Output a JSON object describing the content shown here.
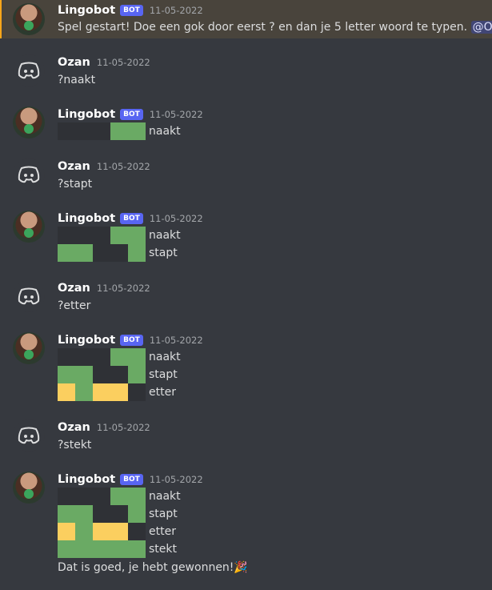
{
  "messages": {
    "m1": {
      "author": "Lingobot",
      "badge": "BOT",
      "time": "11-05-2022",
      "text": "Spel gestart! Doe een gok door eerst ? en dan je 5 letter woord te typen.",
      "mention": "@Ozan"
    },
    "m2": {
      "author": "Ozan",
      "time": "11-05-2022",
      "text": "?naakt"
    },
    "m3": {
      "author": "Lingobot",
      "badge": "BOT",
      "time": "11-05-2022",
      "rows": [
        {
          "word": "naakt",
          "cells": [
            "d",
            "d",
            "d",
            "g",
            "g"
          ]
        }
      ]
    },
    "m4": {
      "author": "Ozan",
      "time": "11-05-2022",
      "text": "?stapt"
    },
    "m5": {
      "author": "Lingobot",
      "badge": "BOT",
      "time": "11-05-2022",
      "rows": [
        {
          "word": "naakt",
          "cells": [
            "d",
            "d",
            "d",
            "g",
            "g"
          ]
        },
        {
          "word": "stapt",
          "cells": [
            "g",
            "g",
            "d",
            "d",
            "g"
          ]
        }
      ]
    },
    "m6": {
      "author": "Ozan",
      "time": "11-05-2022",
      "text": "?etter"
    },
    "m7": {
      "author": "Lingobot",
      "badge": "BOT",
      "time": "11-05-2022",
      "rows": [
        {
          "word": "naakt",
          "cells": [
            "d",
            "d",
            "d",
            "g",
            "g"
          ]
        },
        {
          "word": "stapt",
          "cells": [
            "g",
            "g",
            "d",
            "d",
            "g"
          ]
        },
        {
          "word": "etter",
          "cells": [
            "y",
            "g",
            "y",
            "y",
            "d"
          ]
        }
      ]
    },
    "m8": {
      "author": "Ozan",
      "time": "11-05-2022",
      "text": "?stekt"
    },
    "m9": {
      "author": "Lingobot",
      "badge": "BOT",
      "time": "11-05-2022",
      "rows": [
        {
          "word": "naakt",
          "cells": [
            "d",
            "d",
            "d",
            "g",
            "g"
          ]
        },
        {
          "word": "stapt",
          "cells": [
            "g",
            "g",
            "d",
            "d",
            "g"
          ]
        },
        {
          "word": "etter",
          "cells": [
            "y",
            "g",
            "y",
            "y",
            "d"
          ]
        },
        {
          "word": "stekt",
          "cells": [
            "g",
            "g",
            "g",
            "g",
            "g"
          ]
        }
      ],
      "text": "Dat is goed, je hebt gewonnen!",
      "emoji": "🎉"
    }
  },
  "colors": {
    "correct": "#6aaa64",
    "present": "#fbcf5f",
    "absent": "#2f3136",
    "highlight": "#49443c",
    "mention_bar": "#faa61a"
  },
  "icons": {
    "bot_avatar": "lingobot-avatar",
    "user_avatar": "discord-logo-icon"
  }
}
